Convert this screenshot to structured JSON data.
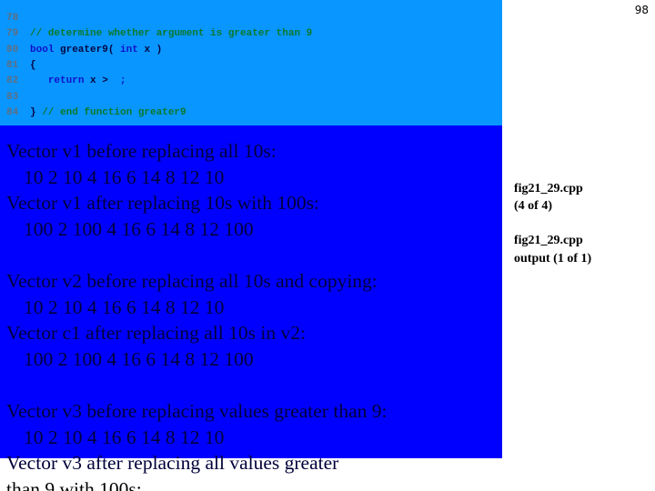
{
  "page_number": "98",
  "code": {
    "lines": [
      {
        "number": "78",
        "tokens": []
      },
      {
        "number": "79",
        "tokens": [
          {
            "type": "comment",
            "text": "// determine whether argument is greater than 9"
          }
        ]
      },
      {
        "number": "80",
        "tokens": [
          {
            "type": "keyword",
            "text": "bool"
          },
          {
            "type": "ident",
            "text": " greater9( "
          },
          {
            "type": "keyword",
            "text": "int"
          },
          {
            "type": "ident",
            "text": " x )"
          }
        ]
      },
      {
        "number": "81",
        "tokens": [
          {
            "type": "ident",
            "text": "{"
          }
        ]
      },
      {
        "number": "82",
        "tokens": [
          {
            "type": "ident",
            "text": "   "
          },
          {
            "type": "keyword",
            "text": "return"
          },
          {
            "type": "ident",
            "text": " x > "
          },
          {
            "type": "keyword",
            "text": " ;"
          }
        ]
      },
      {
        "number": "83",
        "tokens": []
      },
      {
        "number": "84",
        "tokens": [
          {
            "type": "ident",
            "text": "}"
          },
          {
            "type": "comment",
            "text": " // end function greater9"
          }
        ]
      }
    ]
  },
  "output": {
    "lines": [
      {
        "kind": "label",
        "text": "Vector v1 before replacing all 10s:"
      },
      {
        "kind": "values",
        "text": "10 2 10 4 16 6 14 8 12 10"
      },
      {
        "kind": "label",
        "text": "Vector v1 after replacing 10s with 100s:"
      },
      {
        "kind": "values",
        "text": "100 2 100 4 16 6 14 8 12 100"
      },
      {
        "kind": "blank",
        "text": ""
      },
      {
        "kind": "label",
        "text": "Vector v2 before replacing all 10s and copying:"
      },
      {
        "kind": "values",
        "text": "10 2 10 4 16 6 14 8 12 10"
      },
      {
        "kind": "label",
        "text": "Vector c1 after replacing all 10s in v2:"
      },
      {
        "kind": "values",
        "text": "100 2 100 4 16 6 14 8 12 100"
      },
      {
        "kind": "blank",
        "text": ""
      },
      {
        "kind": "label",
        "text": "Vector v3 before replacing values greater than 9:"
      },
      {
        "kind": "values",
        "text": "10 2 10 4 16 6 14 8 12 10"
      },
      {
        "kind": "label",
        "text": "Vector v3 after replacing all values greater"
      },
      {
        "kind": "label",
        "text": "than 9 with 100s:"
      }
    ]
  },
  "captions": {
    "source_title": "fig21_29.cpp",
    "source_part": "(4 of 4)",
    "output_title": "fig21_29.cpp",
    "output_part": "output (1 of 1)"
  }
}
